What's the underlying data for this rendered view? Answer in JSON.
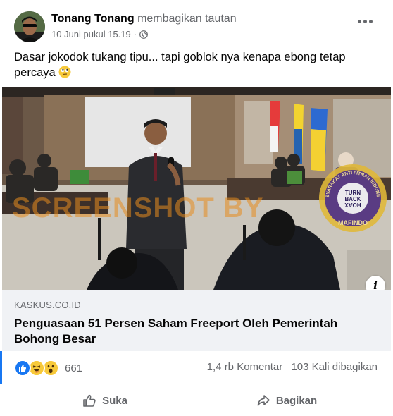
{
  "post": {
    "author": "Tonang Tonang",
    "action": "membagikan tautan",
    "timestamp": "10 Juni pukul 15.19",
    "separator": "·",
    "privacy_icon": "globe-icon",
    "text": "Dasar jokodok tukang tipu... tapi goblok nya kenapa ebong tetap percaya",
    "text_emoji": "rolling-eyes-emoji"
  },
  "photo": {
    "watermark": "SCREENSHOT BY",
    "badge_top": "MASYARAKAT ANTI FITNAH INDONESIA",
    "badge_center": [
      "TURN",
      "BACK",
      "HOAX"
    ],
    "badge_bottom": "MAFINDO",
    "info_label": "i"
  },
  "link": {
    "domain": "KASKUS.CO.ID",
    "title": "Penguasaan 51 Persen Saham Freeport Oleh Pemerintah Bohong Besar"
  },
  "stats": {
    "reactions": [
      "like",
      "haha",
      "wow"
    ],
    "reaction_count": "661",
    "comments": "1,4 rb Komentar",
    "shares": "103 Kali dibagikan"
  },
  "actions": {
    "like_label": "Suka",
    "share_label": "Bagikan"
  },
  "colors": {
    "accent": "#1877f2",
    "secondary_text": "#65676b",
    "link_bg": "#f0f2f5",
    "watermark": "#e88c1e"
  }
}
